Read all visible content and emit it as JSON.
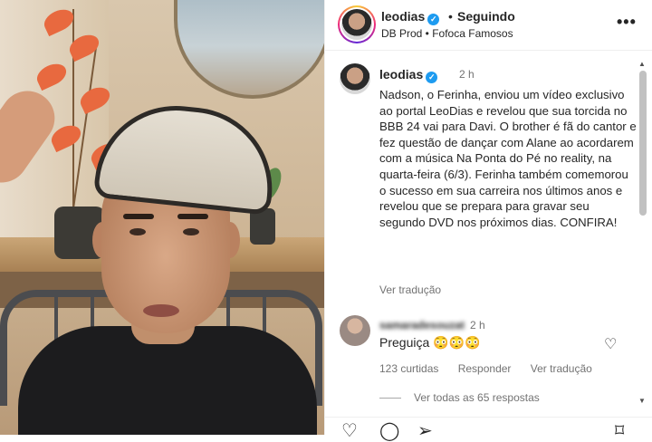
{
  "header": {
    "username": "leodias",
    "separator": "•",
    "follow_status": "Seguindo",
    "subtitle": "DB Prod • Fofoca Famosos",
    "more_icon": "more-horizontal-icon"
  },
  "caption": {
    "username": "leodias",
    "time": "2 h",
    "text": "Nadson, o Ferinha, enviou um vídeo exclusivo ao portal LeoDias e revelou que sua torcida no BBB 24 vai para Davi. O brother é fã do cantor e fez questão de dançar com Alane ao acordarem com a música Na Ponta do Pé no reality, na quarta-feira (6/3). Ferinha também comemorou o sucesso em sua carreira nos últimos anos e revelou que se prepara para gravar seu segundo DVD nos próximos dias. CONFIRA!",
    "translate": "Ver tradução"
  },
  "comment": {
    "username": "samaradesouzat",
    "time": "2 h",
    "text": "Preguiça 😳😳😳",
    "likes": "123 curtidas",
    "reply": "Responder",
    "translate": "Ver tradução",
    "view_replies": "Ver todas as 65 respostas"
  },
  "actions": {
    "like_icon": "heart-icon",
    "comment_icon": "comment-icon",
    "share_icon": "send-icon",
    "save_icon": "bookmark-icon"
  },
  "colors": {
    "verified": "#1d9bf0",
    "text": "#262626",
    "secondary": "#737373"
  }
}
